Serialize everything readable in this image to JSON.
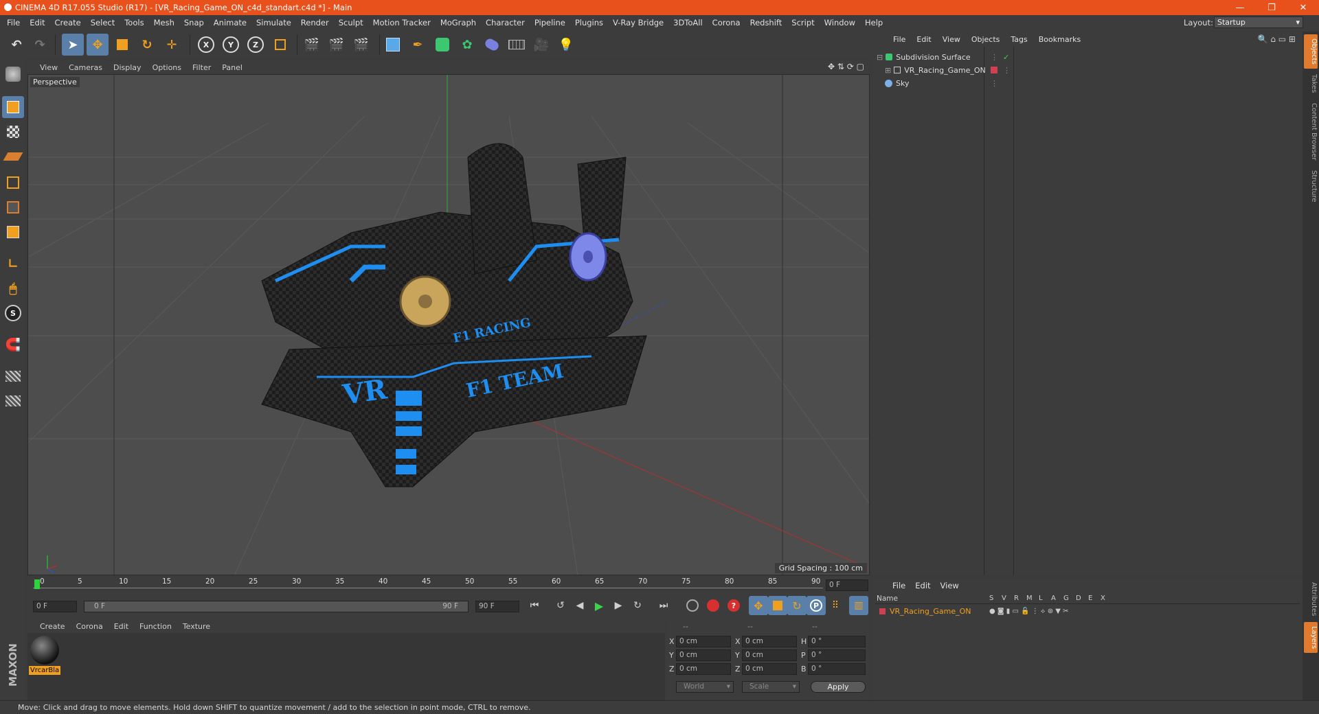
{
  "window": {
    "title": "CINEMA 4D R17.055 Studio (R17) - [VR_Racing_Game_ON_c4d_standart.c4d *] - Main",
    "minimize": "—",
    "restore": "❐",
    "close": "✕"
  },
  "menu": [
    "File",
    "Edit",
    "Create",
    "Select",
    "Tools",
    "Mesh",
    "Snap",
    "Animate",
    "Simulate",
    "Render",
    "Sculpt",
    "Motion Tracker",
    "MoGraph",
    "Character",
    "Pipeline",
    "Plugins",
    "V-Ray Bridge",
    "3DToAll",
    "Corona",
    "Redshift",
    "Script",
    "Window",
    "Help"
  ],
  "layout": {
    "label": "Layout:",
    "value": "Startup"
  },
  "toolbar": {
    "x_label": "X",
    "y_label": "Y",
    "z_label": "Z"
  },
  "viewport": {
    "menu": [
      "View",
      "Cameras",
      "Display",
      "Options",
      "Filter",
      "Panel"
    ],
    "label": "Perspective",
    "grid_spacing": "Grid Spacing : 100 cm",
    "text_vr": "VR",
    "text_team": "F1 TEAM",
    "text_racing": "F1 RACING"
  },
  "timeline": {
    "ticks": [
      "0",
      "5",
      "10",
      "15",
      "20",
      "25",
      "30",
      "35",
      "40",
      "45",
      "50",
      "55",
      "60",
      "65",
      "70",
      "75",
      "80",
      "85",
      "90"
    ],
    "current_frame": "0 F",
    "start": "0 F",
    "slider_start": "0 F",
    "slider_end": "90 F",
    "end": "90 F"
  },
  "materials": {
    "menu": [
      "Create",
      "Corona",
      "Edit",
      "Function",
      "Texture"
    ],
    "item_label": "VrcarBla"
  },
  "coords": {
    "head": [
      "--",
      "--",
      "--"
    ],
    "rows": [
      {
        "a": "X",
        "av": "0 cm",
        "b": "X",
        "bv": "0 cm",
        "c": "H",
        "cv": "0 °"
      },
      {
        "a": "Y",
        "av": "0 cm",
        "b": "Y",
        "bv": "0 cm",
        "c": "P",
        "cv": "0 °"
      },
      {
        "a": "Z",
        "av": "0 cm",
        "b": "Z",
        "bv": "0 cm",
        "c": "B",
        "cv": "0 °"
      }
    ],
    "world": "World",
    "scale": "Scale",
    "apply": "Apply"
  },
  "objects": {
    "menu": [
      "File",
      "Edit",
      "View",
      "Objects",
      "Tags",
      "Bookmarks"
    ],
    "items": [
      "Subdivision Surface",
      "VR_Racing_Game_ON",
      "Sky"
    ]
  },
  "layers": {
    "menu": [
      "File",
      "Edit",
      "View"
    ],
    "name_header": "Name",
    "cols": [
      "S",
      "V",
      "R",
      "M",
      "L",
      "A",
      "G",
      "D",
      "E",
      "X"
    ],
    "item": "VR_Racing_Game_ON"
  },
  "right_tabs": [
    "Objects",
    "Takes",
    "Content Browser",
    "Structure",
    "Attributes",
    "Layers"
  ],
  "brand": "MAXON CINEMA 4D",
  "status": "Move: Click and drag to move elements. Hold down SHIFT to quantize movement / add to the selection in point mode, CTRL to remove.",
  "colors": {
    "titlebar": "#e8501c",
    "accent": "#5a7fa8",
    "highlight": "#e07a2e",
    "neon": "#1e8ff0"
  }
}
